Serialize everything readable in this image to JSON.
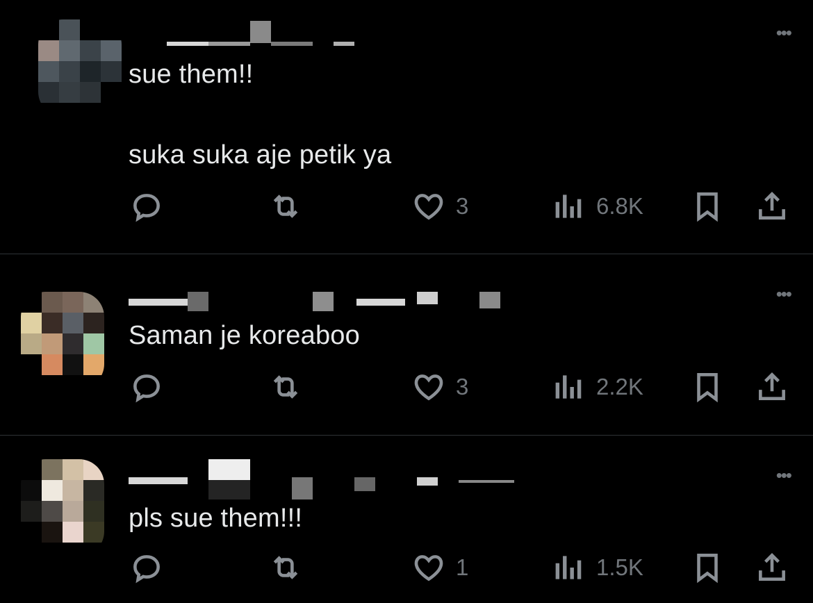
{
  "tweets": [
    {
      "lines": [
        "sue them!!",
        "suka suka aje petik ya"
      ],
      "stats": {
        "likes": "3",
        "views": "6.8K"
      }
    },
    {
      "lines": [
        "Saman je koreaboo"
      ],
      "stats": {
        "likes": "3",
        "views": "2.2K"
      }
    },
    {
      "lines": [
        "pls sue them!!!"
      ],
      "stats": {
        "likes": "1",
        "views": "1.5K"
      }
    }
  ],
  "ui": {
    "more_glyph": "•••"
  },
  "colors": {
    "background": "#000000",
    "text": "#e7e9ea",
    "muted": "#71767b",
    "divider": "#2f3336"
  },
  "icons": [
    "reply-icon",
    "retweet-icon",
    "heart-icon",
    "views-icon",
    "bookmark-icon",
    "share-icon"
  ]
}
